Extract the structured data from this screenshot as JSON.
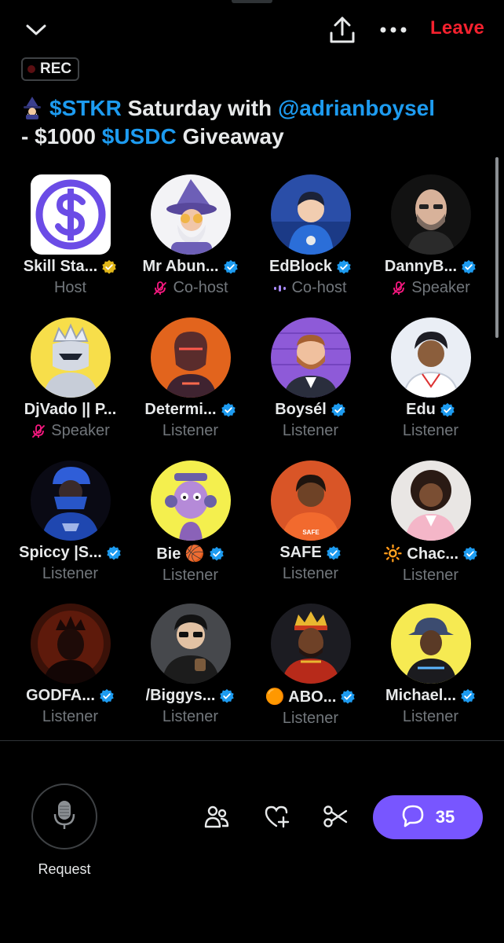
{
  "topbar": {
    "leave_label": "Leave",
    "icons": [
      "chevron-down-icon",
      "share-icon",
      "more-icon"
    ]
  },
  "rec_badge": {
    "label": "REC"
  },
  "title": {
    "emoji": "wizard-emoji",
    "part1": "$STKR",
    "part2": " Saturday with ",
    "part3": "@adrianboysel",
    "part4": "- $1000 ",
    "part5": "$USDC",
    "part6": " Giveaway",
    "link_color": "#1d9bf0"
  },
  "participants": [
    {
      "name": "Skill Sta...",
      "role": "Host",
      "badge": "gold",
      "role_icon": "none",
      "avatar": "dollar-logo"
    },
    {
      "name": "Mr Abun...",
      "role": "Co-host",
      "badge": "blue",
      "role_icon": "muted",
      "avatar": "wizard-grandpa"
    },
    {
      "name": "EdBlock",
      "role": "Co-host",
      "badge": "blue",
      "role_icon": "speaking",
      "avatar": "hoodie-boy"
    },
    {
      "name": "DannyB...",
      "role": "Speaker",
      "badge": "blue",
      "role_icon": "muted",
      "avatar": "bald-man"
    },
    {
      "name": "DjVado || P...",
      "role": "Speaker",
      "badge": "none",
      "role_icon": "muted",
      "avatar": "crown-knight"
    },
    {
      "name": "Determi...",
      "role": "Listener",
      "badge": "blue",
      "role_icon": "none",
      "avatar": "cyborg"
    },
    {
      "name": "Boysél",
      "role": "Listener",
      "badge": "blue",
      "role_icon": "none",
      "avatar": "bearded-man"
    },
    {
      "name": "Edu",
      "role": "Listener",
      "badge": "blue",
      "role_icon": "none",
      "avatar": "anime-boy"
    },
    {
      "name": "Spiccy |S...",
      "role": "Listener",
      "badge": "blue",
      "role_icon": "none",
      "avatar": "blue-warrior"
    },
    {
      "name": "Bie 🏀",
      "role": "Listener",
      "badge": "blue",
      "role_icon": "none",
      "avatar": "purple-cartoon"
    },
    {
      "name": "SAFE",
      "role": "Listener",
      "badge": "blue",
      "role_icon": "none",
      "avatar": "safe-woman"
    },
    {
      "name": "🔆 Chac...",
      "role": "Listener",
      "badge": "blue",
      "role_icon": "none",
      "avatar": "pink-woman"
    },
    {
      "name": "GODFA...",
      "role": "Listener",
      "badge": "blue",
      "role_icon": "none",
      "avatar": "dark-king"
    },
    {
      "name": "/Biggys...",
      "role": "Listener",
      "badge": "blue",
      "role_icon": "none",
      "avatar": "sunglasses-guy"
    },
    {
      "name": "🟠 ABO...",
      "role": "Listener",
      "badge": "blue",
      "role_icon": "none",
      "avatar": "crowned-man"
    },
    {
      "name": "Michael...",
      "role": "Listener",
      "badge": "blue",
      "role_icon": "none",
      "avatar": "bucket-hat-man"
    }
  ],
  "bottom": {
    "request_label": "Request",
    "comments_count": "35",
    "accent_color": "#7856ff",
    "icons": [
      "mic-icon",
      "people-icon",
      "heart-plus-icon",
      "clip-icon",
      "comment-icon"
    ]
  }
}
